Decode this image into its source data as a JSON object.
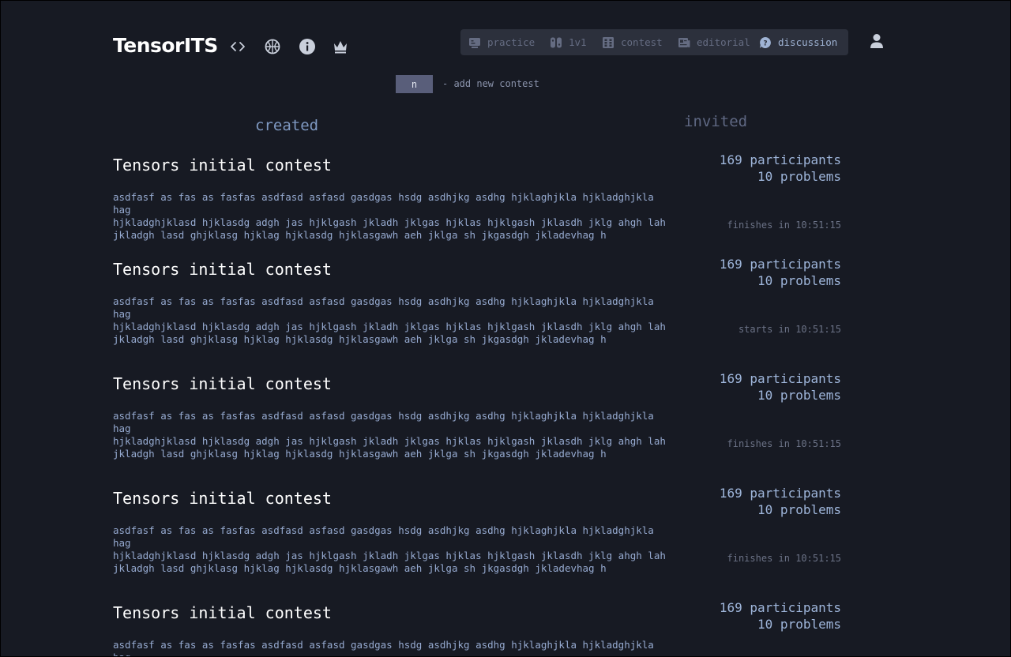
{
  "header": {
    "logo": "TensorITS",
    "icons": [
      "code-icon",
      "globe-icon",
      "info-icon",
      "crown-icon"
    ]
  },
  "nav": {
    "items": [
      {
        "label": "practice",
        "icon": "monitor-icon"
      },
      {
        "label": "1v1",
        "icon": "versus-icon"
      },
      {
        "label": "contest",
        "icon": "grid-icon"
      },
      {
        "label": "editorial",
        "icon": "editorial-icon"
      },
      {
        "label": "discussion",
        "icon": "question-bubble-icon"
      }
    ],
    "active": "discussion"
  },
  "add_contest": {
    "key": "n",
    "hint": "- add new contest"
  },
  "columns": {
    "created": "created",
    "invited": "invited"
  },
  "contests": [
    {
      "title": "Tensors initial contest",
      "description": "asdfasf as fas as fasfas asdfasd asfasd gasdgas hsdg asdhjkg asdhg hjklaghjkla hjkladghjkla hag\nhjkladghjklasd hjklasdg adgh jas hjklgash jkladh jklgas hjklas hjklgash jklasdh jklg ahgh lah\njkladgh lasd ghjklasg hjklag hjklasdg hjklasgawh aeh jklga sh jkgasdgh jkladevhag h",
      "participants": "169 participants",
      "problems": "10 problems",
      "status": "finishes in 10:51:15"
    },
    {
      "title": "Tensors initial contest",
      "description": "asdfasf as fas as fasfas asdfasd asfasd gasdgas hsdg asdhjkg asdhg hjklaghjkla hjkladghjkla hag\nhjkladghjklasd hjklasdg adgh jas hjklgash jkladh jklgas hjklas hjklgash jklasdh jklg ahgh lah\njkladgh lasd ghjklasg hjklag hjklasdg hjklasgawh aeh jklga sh jkgasdgh jkladevhag h",
      "participants": "169 participants",
      "problems": "10 problems",
      "status": "starts in 10:51:15"
    },
    {
      "title": "Tensors initial contest",
      "description": "asdfasf as fas as fasfas asdfasd asfasd gasdgas hsdg asdhjkg asdhg hjklaghjkla hjkladghjkla hag\nhjkladghjklasd hjklasdg adgh jas hjklgash jkladh jklgas hjklas hjklgash jklasdh jklg ahgh lah\njkladgh lasd ghjklasg hjklag hjklasdg hjklasgawh aeh jklga sh jkgasdgh jkladevhag h",
      "participants": "169 participants",
      "problems": "10 problems",
      "status": "finishes in 10:51:15"
    },
    {
      "title": "Tensors initial contest",
      "description": "asdfasf as fas as fasfas asdfasd asfasd gasdgas hsdg asdhjkg asdhg hjklaghjkla hjkladghjkla hag\nhjkladghjklasd hjklasdg adgh jas hjklgash jkladh jklgas hjklas hjklgash jklasdh jklg ahgh lah\njkladgh lasd ghjklasg hjklag hjklasdg hjklasgawh aeh jklga sh jkgasdgh jkladevhag h",
      "participants": "169 participants",
      "problems": "10 problems",
      "status": "finishes in 10:51:15"
    },
    {
      "title": "Tensors initial contest",
      "description": "asdfasf as fas as fasfas asdfasd asfasd gasdgas hsdg asdhjkg asdhg hjklaghjkla hjkladghjkla hag\nhjkladghjklasd hjklasdg adgh jas hjklgash jkladh jklgas hjklas hjklgash jklasdh jklg ahgh lah\njkladgh lasd ghjklasg hjklag hjklasdg hjklasgawh aeh jklga sh jkgasdgh jkladevhag h",
      "participants": "169 participants",
      "problems": "10 problems",
      "status": ""
    }
  ],
  "colors": {
    "background": "#171a23",
    "nav_background": "#2c303c",
    "accent": "#7f99c2",
    "key_button": "#595e7a"
  }
}
